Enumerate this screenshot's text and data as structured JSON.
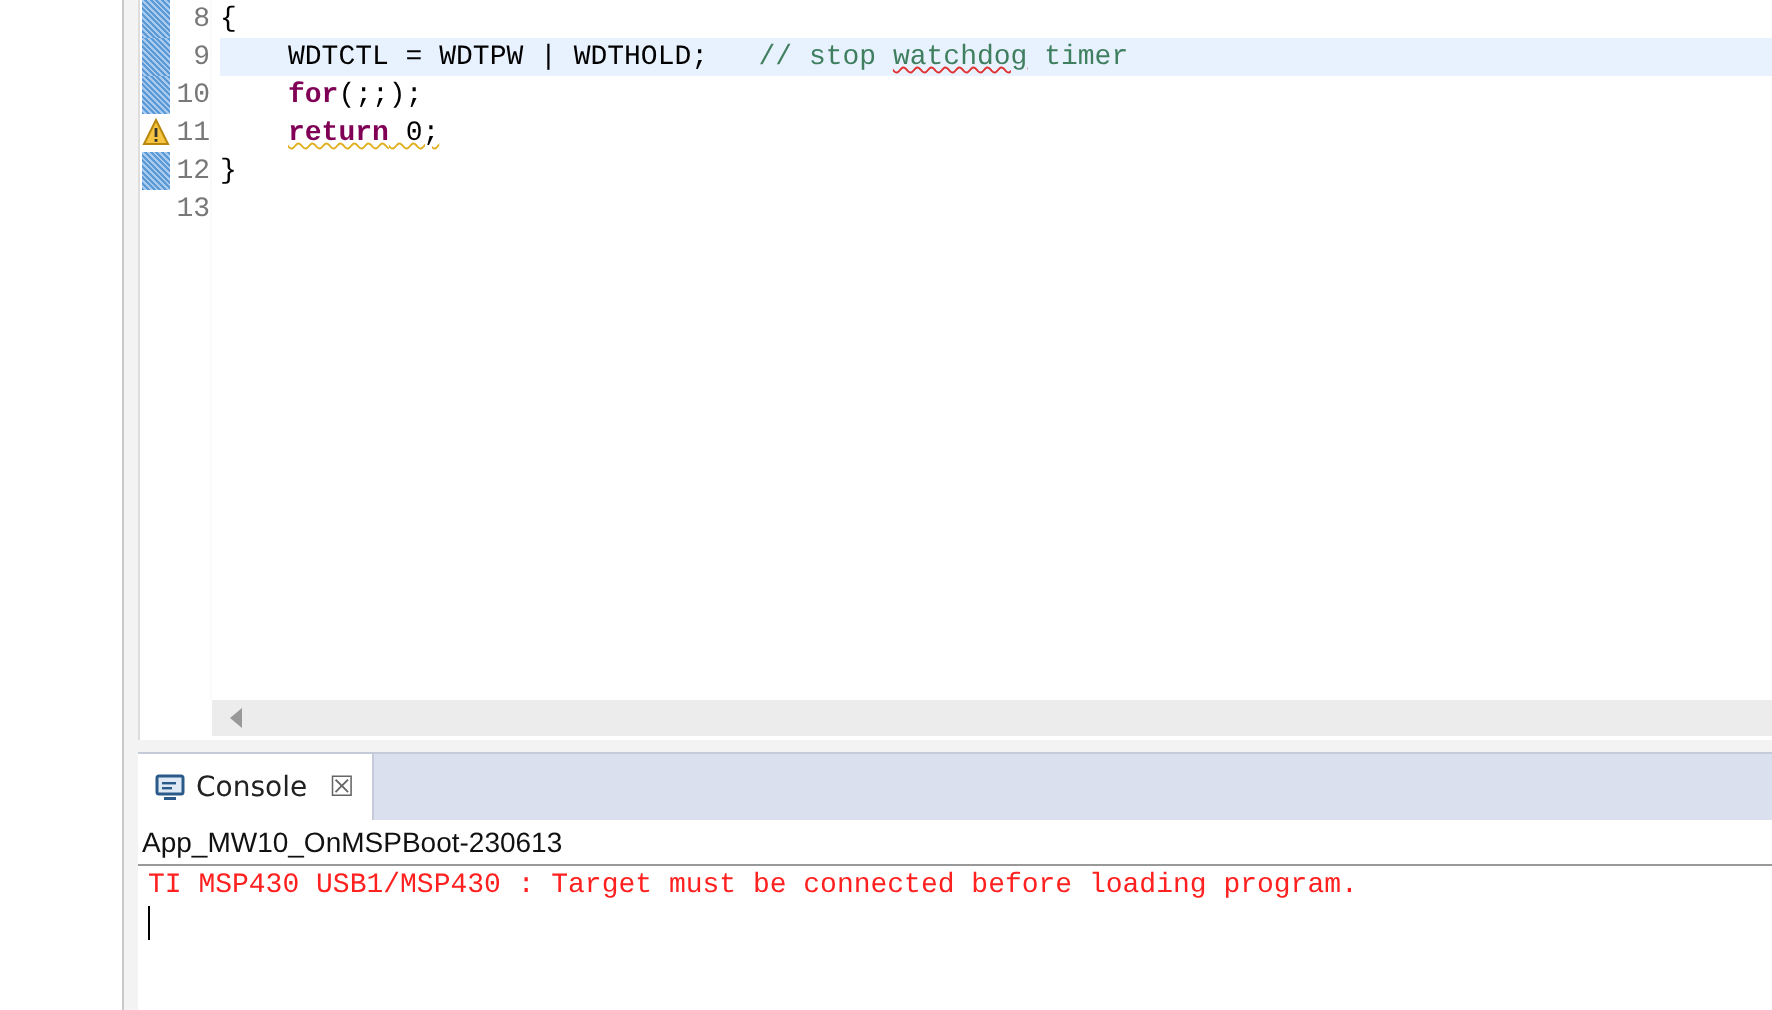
{
  "editor": {
    "lines": [
      {
        "number": "8",
        "changed": true,
        "warning": false,
        "selected": false,
        "indented": false,
        "tokens": [
          {
            "kind": "plain",
            "text": "{"
          }
        ]
      },
      {
        "number": "9",
        "changed": true,
        "warning": false,
        "selected": true,
        "indented": true,
        "tokens": [
          {
            "kind": "plain",
            "text": "WDTCTL = WDTPW | WDTHOLD;   "
          },
          {
            "kind": "comment",
            "text": "// stop "
          },
          {
            "kind": "comment",
            "text": "watchdog",
            "misspelled": true
          },
          {
            "kind": "comment",
            "text": " timer"
          }
        ]
      },
      {
        "number": "10",
        "changed": true,
        "warning": false,
        "selected": false,
        "indented": true,
        "tokens": [
          {
            "kind": "keyword",
            "text": "for"
          },
          {
            "kind": "plain",
            "text": "(;;);"
          }
        ]
      },
      {
        "number": "11",
        "changed": false,
        "warning": true,
        "selected": false,
        "indented": true,
        "tokens": [
          {
            "kind": "keyword",
            "text": "return",
            "warned": true
          },
          {
            "kind": "plain",
            "text": " 0;",
            "warned": true
          }
        ]
      },
      {
        "number": "12",
        "changed": true,
        "warning": false,
        "selected": false,
        "indented": false,
        "tokens": [
          {
            "kind": "plain",
            "text": "}"
          }
        ]
      },
      {
        "number": "13",
        "changed": false,
        "warning": false,
        "selected": false,
        "indented": false
      }
    ]
  },
  "console": {
    "tab": {
      "label": "Console",
      "close": "☒"
    },
    "title": "App_MW10_OnMSPBoot-230613",
    "output": [
      {
        "kind": "error",
        "text": "TI MSP430 USB1/MSP430 : Target must be connected before loading program."
      }
    ]
  }
}
